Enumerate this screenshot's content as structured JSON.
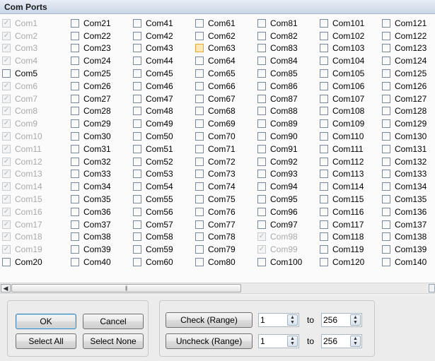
{
  "window": {
    "title": "Com Ports"
  },
  "ports": {
    "columns": [
      [
        {
          "label": "Com1",
          "state": "checked-disabled"
        },
        {
          "label": "Com2",
          "state": "checked-disabled"
        },
        {
          "label": "Com3",
          "state": "checked-disabled"
        },
        {
          "label": "Com4",
          "state": "checked-disabled"
        },
        {
          "label": "Com5",
          "state": "unchecked"
        },
        {
          "label": "Com6",
          "state": "checked-disabled"
        },
        {
          "label": "Com7",
          "state": "checked-disabled"
        },
        {
          "label": "Com8",
          "state": "checked-disabled"
        },
        {
          "label": "Com9",
          "state": "checked-disabled"
        },
        {
          "label": "Com10",
          "state": "checked-disabled"
        },
        {
          "label": "Com11",
          "state": "checked-disabled"
        },
        {
          "label": "Com12",
          "state": "checked-disabled"
        },
        {
          "label": "Com13",
          "state": "checked-disabled"
        },
        {
          "label": "Com14",
          "state": "checked-disabled"
        },
        {
          "label": "Com15",
          "state": "checked-disabled"
        },
        {
          "label": "Com16",
          "state": "checked-disabled"
        },
        {
          "label": "Com17",
          "state": "checked-disabled"
        },
        {
          "label": "Com18",
          "state": "checked-disabled"
        },
        {
          "label": "Com19",
          "state": "checked-disabled"
        },
        {
          "label": "Com20",
          "state": "unchecked"
        }
      ],
      [
        {
          "label": "Com21",
          "state": "unchecked"
        },
        {
          "label": "Com22",
          "state": "unchecked"
        },
        {
          "label": "Com23",
          "state": "unchecked"
        },
        {
          "label": "Com24",
          "state": "unchecked"
        },
        {
          "label": "Com25",
          "state": "unchecked"
        },
        {
          "label": "Com26",
          "state": "unchecked"
        },
        {
          "label": "Com27",
          "state": "unchecked"
        },
        {
          "label": "Com28",
          "state": "unchecked"
        },
        {
          "label": "Com29",
          "state": "unchecked"
        },
        {
          "label": "Com30",
          "state": "unchecked"
        },
        {
          "label": "Com31",
          "state": "unchecked"
        },
        {
          "label": "Com32",
          "state": "unchecked"
        },
        {
          "label": "Com33",
          "state": "unchecked"
        },
        {
          "label": "Com34",
          "state": "unchecked"
        },
        {
          "label": "Com35",
          "state": "unchecked"
        },
        {
          "label": "Com36",
          "state": "unchecked"
        },
        {
          "label": "Com37",
          "state": "unchecked"
        },
        {
          "label": "Com38",
          "state": "unchecked"
        },
        {
          "label": "Com39",
          "state": "unchecked"
        },
        {
          "label": "Com40",
          "state": "unchecked"
        }
      ],
      [
        {
          "label": "Com41",
          "state": "unchecked"
        },
        {
          "label": "Com42",
          "state": "unchecked"
        },
        {
          "label": "Com43",
          "state": "unchecked"
        },
        {
          "label": "Com44",
          "state": "unchecked"
        },
        {
          "label": "Com45",
          "state": "unchecked"
        },
        {
          "label": "Com46",
          "state": "unchecked"
        },
        {
          "label": "Com47",
          "state": "unchecked"
        },
        {
          "label": "Com48",
          "state": "unchecked"
        },
        {
          "label": "Com49",
          "state": "unchecked"
        },
        {
          "label": "Com50",
          "state": "unchecked"
        },
        {
          "label": "Com51",
          "state": "unchecked"
        },
        {
          "label": "Com52",
          "state": "unchecked"
        },
        {
          "label": "Com53",
          "state": "unchecked"
        },
        {
          "label": "Com54",
          "state": "unchecked"
        },
        {
          "label": "Com55",
          "state": "unchecked"
        },
        {
          "label": "Com56",
          "state": "unchecked"
        },
        {
          "label": "Com57",
          "state": "unchecked"
        },
        {
          "label": "Com58",
          "state": "unchecked"
        },
        {
          "label": "Com59",
          "state": "unchecked"
        },
        {
          "label": "Com60",
          "state": "unchecked"
        }
      ],
      [
        {
          "label": "Com61",
          "state": "unchecked"
        },
        {
          "label": "Com62",
          "state": "unchecked"
        },
        {
          "label": "Com63",
          "state": "hover"
        },
        {
          "label": "Com64",
          "state": "unchecked"
        },
        {
          "label": "Com65",
          "state": "unchecked"
        },
        {
          "label": "Com66",
          "state": "unchecked"
        },
        {
          "label": "Com67",
          "state": "unchecked"
        },
        {
          "label": "Com68",
          "state": "unchecked"
        },
        {
          "label": "Com69",
          "state": "unchecked"
        },
        {
          "label": "Com70",
          "state": "unchecked"
        },
        {
          "label": "Com71",
          "state": "unchecked"
        },
        {
          "label": "Com72",
          "state": "unchecked"
        },
        {
          "label": "Com73",
          "state": "unchecked"
        },
        {
          "label": "Com74",
          "state": "unchecked"
        },
        {
          "label": "Com75",
          "state": "unchecked"
        },
        {
          "label": "Com76",
          "state": "unchecked"
        },
        {
          "label": "Com77",
          "state": "unchecked"
        },
        {
          "label": "Com78",
          "state": "unchecked"
        },
        {
          "label": "Com79",
          "state": "unchecked"
        },
        {
          "label": "Com80",
          "state": "unchecked"
        }
      ],
      [
        {
          "label": "Com81",
          "state": "unchecked"
        },
        {
          "label": "Com82",
          "state": "unchecked"
        },
        {
          "label": "Com83",
          "state": "unchecked"
        },
        {
          "label": "Com84",
          "state": "unchecked"
        },
        {
          "label": "Com85",
          "state": "unchecked"
        },
        {
          "label": "Com86",
          "state": "unchecked"
        },
        {
          "label": "Com87",
          "state": "unchecked"
        },
        {
          "label": "Com88",
          "state": "unchecked"
        },
        {
          "label": "Com89",
          "state": "unchecked"
        },
        {
          "label": "Com90",
          "state": "unchecked"
        },
        {
          "label": "Com91",
          "state": "unchecked"
        },
        {
          "label": "Com92",
          "state": "unchecked"
        },
        {
          "label": "Com93",
          "state": "unchecked"
        },
        {
          "label": "Com94",
          "state": "unchecked"
        },
        {
          "label": "Com95",
          "state": "unchecked"
        },
        {
          "label": "Com96",
          "state": "unchecked"
        },
        {
          "label": "Com97",
          "state": "unchecked"
        },
        {
          "label": "Com98",
          "state": "checked-disabled"
        },
        {
          "label": "Com99",
          "state": "checked-disabled"
        },
        {
          "label": "Com100",
          "state": "unchecked"
        }
      ],
      [
        {
          "label": "Com101",
          "state": "unchecked"
        },
        {
          "label": "Com102",
          "state": "unchecked"
        },
        {
          "label": "Com103",
          "state": "unchecked"
        },
        {
          "label": "Com104",
          "state": "unchecked"
        },
        {
          "label": "Com105",
          "state": "unchecked"
        },
        {
          "label": "Com106",
          "state": "unchecked"
        },
        {
          "label": "Com107",
          "state": "unchecked"
        },
        {
          "label": "Com108",
          "state": "unchecked"
        },
        {
          "label": "Com109",
          "state": "unchecked"
        },
        {
          "label": "Com110",
          "state": "unchecked"
        },
        {
          "label": "Com111",
          "state": "unchecked"
        },
        {
          "label": "Com112",
          "state": "unchecked"
        },
        {
          "label": "Com113",
          "state": "unchecked"
        },
        {
          "label": "Com114",
          "state": "unchecked"
        },
        {
          "label": "Com115",
          "state": "unchecked"
        },
        {
          "label": "Com116",
          "state": "unchecked"
        },
        {
          "label": "Com117",
          "state": "unchecked"
        },
        {
          "label": "Com118",
          "state": "unchecked"
        },
        {
          "label": "Com119",
          "state": "unchecked"
        },
        {
          "label": "Com120",
          "state": "unchecked"
        }
      ],
      [
        {
          "label": "Com121",
          "state": "unchecked"
        },
        {
          "label": "Com122",
          "state": "unchecked"
        },
        {
          "label": "Com123",
          "state": "unchecked"
        },
        {
          "label": "Com124",
          "state": "unchecked"
        },
        {
          "label": "Com125",
          "state": "unchecked"
        },
        {
          "label": "Com126",
          "state": "unchecked"
        },
        {
          "label": "Com127",
          "state": "unchecked"
        },
        {
          "label": "Com128",
          "state": "unchecked"
        },
        {
          "label": "Com129",
          "state": "unchecked"
        },
        {
          "label": "Com130",
          "state": "unchecked"
        },
        {
          "label": "Com131",
          "state": "unchecked"
        },
        {
          "label": "Com132",
          "state": "unchecked"
        },
        {
          "label": "Com133",
          "state": "unchecked"
        },
        {
          "label": "Com134",
          "state": "unchecked"
        },
        {
          "label": "Com135",
          "state": "unchecked"
        },
        {
          "label": "Com136",
          "state": "unchecked"
        },
        {
          "label": "Com137",
          "state": "unchecked"
        },
        {
          "label": "Com138",
          "state": "unchecked"
        },
        {
          "label": "Com139",
          "state": "unchecked"
        },
        {
          "label": "Com140",
          "state": "unchecked"
        }
      ]
    ]
  },
  "icons": {
    "check": "✓",
    "scroll_left": "◀",
    "scroll_grip": "|||",
    "spin_up": "▲",
    "spin_down": "▼"
  },
  "buttons": {
    "ok": "OK",
    "cancel": "Cancel",
    "select_all": "Select All",
    "select_none": "Select None",
    "check_range": "Check (Range)",
    "uncheck_range": "Uncheck (Range)"
  },
  "range": {
    "to_label": "to",
    "check_from": "1",
    "check_to": "256",
    "uncheck_from": "1",
    "uncheck_to": "256"
  },
  "colors": {
    "hover_checkbox": "#fde7b2",
    "disabled_text": "#a9a9a9"
  }
}
